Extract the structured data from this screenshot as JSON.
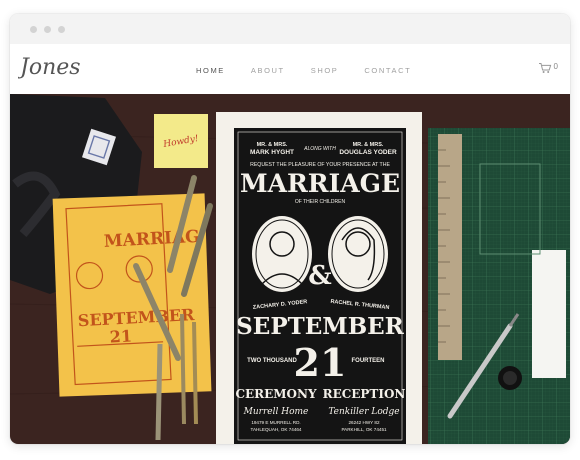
{
  "site": {
    "logo_text": "Jones"
  },
  "nav": {
    "items": [
      {
        "label": "HOME",
        "active": true
      },
      {
        "label": "ABOUT",
        "active": false
      },
      {
        "label": "SHOP",
        "active": false
      },
      {
        "label": "CONTACT",
        "active": false
      }
    ]
  },
  "cart": {
    "count": "0",
    "icon": "cart-icon"
  },
  "hero": {
    "sticky_note": "Howdy!",
    "poster": {
      "top_left": "MR. & MRS.",
      "top_left_name": "MARK HYGHT",
      "along_with": "ALONG WITH",
      "top_right": "MR. & MRS.",
      "top_right_name": "DOUGLAS YODER",
      "request": "REQUEST THE PLEASURE OF YOUR PRESENCE AT THE",
      "title": "MARRIAGE",
      "of_children": "OF THEIR CHILDREN",
      "groom": "ZACHARY D. YODER",
      "bride": "RACHEL R. THURMAN",
      "month": "SEPTEMBER",
      "year_left": "TWO THOUSAND",
      "day": "21",
      "year_right": "FOURTEEN",
      "ceremony": "CEREMONY",
      "reception": "RECEPTION",
      "venue_left": "Murrell Home",
      "venue_right": "Tenkiller Lodge",
      "addr_left": "19479 E MURRELL RD.",
      "addr_left_city": "TAHLEQUAH, OK 74464",
      "addr_right": "26242 HWY 82",
      "addr_right_city": "PARKHILL, OK 74451"
    },
    "yellow_card": {
      "title": "MARRIAG",
      "month": "SEPTEMBER",
      "day": "21"
    }
  },
  "colors": {
    "wood": "#3b2420",
    "mat": "#1e4a36",
    "yellow": "#f3c24a",
    "sticky": "#f3ea8a",
    "ink": "#222222"
  }
}
